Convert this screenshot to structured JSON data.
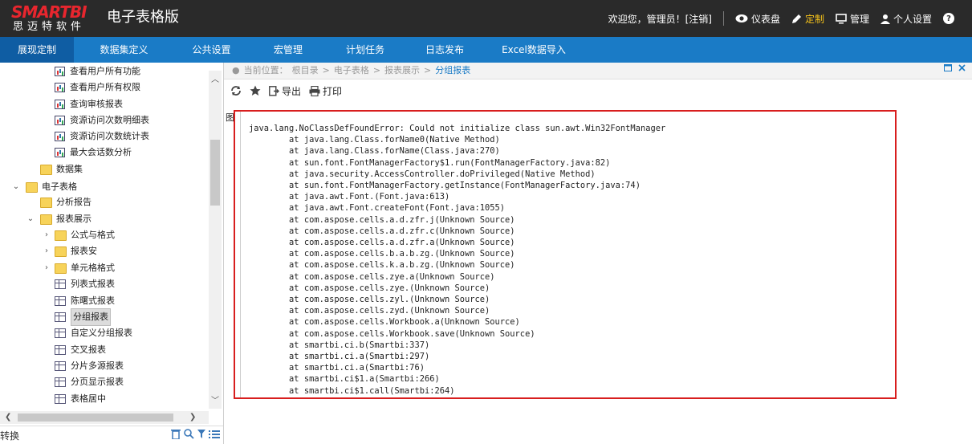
{
  "header": {
    "logo_main": "SMARTBI",
    "logo_sub": "思迈特软件",
    "app_title": "电子表格版",
    "welcome": "欢迎您，管理员！[注销]",
    "items": [
      {
        "label": "仪表盘",
        "icon": "eye-icon"
      },
      {
        "label": "定制",
        "icon": "pencil-icon",
        "active": true
      },
      {
        "label": "管理",
        "icon": "monitor-icon"
      },
      {
        "label": "个人设置",
        "icon": "user-icon"
      }
    ],
    "help": "?"
  },
  "nav": {
    "items": [
      {
        "label": "展现定制"
      },
      {
        "label": "数据集定义"
      },
      {
        "label": "公共设置"
      },
      {
        "label": "宏管理"
      },
      {
        "label": "计划任务"
      },
      {
        "label": "日志发布"
      },
      {
        "label": "Excel数据导入"
      }
    ]
  },
  "tree": {
    "items": [
      {
        "label": "查看用户所有功能",
        "type": "report"
      },
      {
        "label": "查看用户所有权限",
        "type": "report"
      },
      {
        "label": "查询审核报表",
        "type": "report"
      },
      {
        "label": "资源访问次数明细表",
        "type": "report"
      },
      {
        "label": "资源访问次数统计表",
        "type": "report"
      },
      {
        "label": "最大会话数分析",
        "type": "report"
      },
      {
        "label": "数据集",
        "type": "folder"
      },
      {
        "label": "电子表格",
        "type": "folder"
      },
      {
        "label": "分析报告",
        "type": "folder"
      },
      {
        "label": "报表展示",
        "type": "folder"
      },
      {
        "label": "公式与格式",
        "type": "folder"
      },
      {
        "label": "报表安",
        "type": "folder"
      },
      {
        "label": "单元格格式",
        "type": "folder"
      },
      {
        "label": "列表式报表",
        "type": "grid"
      },
      {
        "label": "陈曙式报表",
        "type": "grid"
      },
      {
        "label": "分组报表",
        "type": "grid"
      },
      {
        "label": "自定义分组报表",
        "type": "grid"
      },
      {
        "label": "交叉报表",
        "type": "grid"
      },
      {
        "label": "分片多源报表",
        "type": "grid"
      },
      {
        "label": "分页显示报表",
        "type": "grid"
      },
      {
        "label": "表格居中",
        "type": "grid"
      }
    ],
    "footer_text": "转换"
  },
  "breadcrumb": {
    "items": [
      "当前位置：",
      "根目录",
      ">",
      "电子表格",
      ">",
      "报表展示",
      ">",
      "分组报表"
    ]
  },
  "toolbar": {
    "refresh_icon": "refresh-icon",
    "star_icon": "star-icon",
    "export_label": "导出",
    "print_label": "打印"
  },
  "image_corner": "图",
  "error_trace": "java.lang.NoClassDefFoundError: Could not initialize class sun.awt.Win32FontManager\n        at java.lang.Class.forName0(Native Method)\n        at java.lang.Class.forName(Class.java:270)\n        at sun.font.FontManagerFactory$1.run(FontManagerFactory.java:82)\n        at java.security.AccessController.doPrivileged(Native Method)\n        at sun.font.FontManagerFactory.getInstance(FontManagerFactory.java:74)\n        at java.awt.Font.(Font.java:613)\n        at java.awt.Font.createFont(Font.java:1055)\n        at com.aspose.cells.a.d.zfr.j(Unknown Source)\n        at com.aspose.cells.a.d.zfr.c(Unknown Source)\n        at com.aspose.cells.a.d.zfr.a(Unknown Source)\n        at com.aspose.cells.b.a.b.zg.(Unknown Source)\n        at com.aspose.cells.k.a.b.zg.(Unknown Source)\n        at com.aspose.cells.zye.a(Unknown Source)\n        at com.aspose.cells.zye.(Unknown Source)\n        at com.aspose.cells.zyl.(Unknown Source)\n        at com.aspose.cells.zyd.(Unknown Source)\n        at com.aspose.cells.Workbook.a(Unknown Source)\n        at com.aspose.cells.Workbook.save(Unknown Source)\n        at smartbi.ci.b(Smartbi:337)\n        at smartbi.ci.a(Smartbi:297)\n        at smartbi.ci.a(Smartbi:76)\n        at smartbi.ci$1.a(Smartbi:266)\n        at smartbi.ci$1.call(Smartbi:264)"
}
